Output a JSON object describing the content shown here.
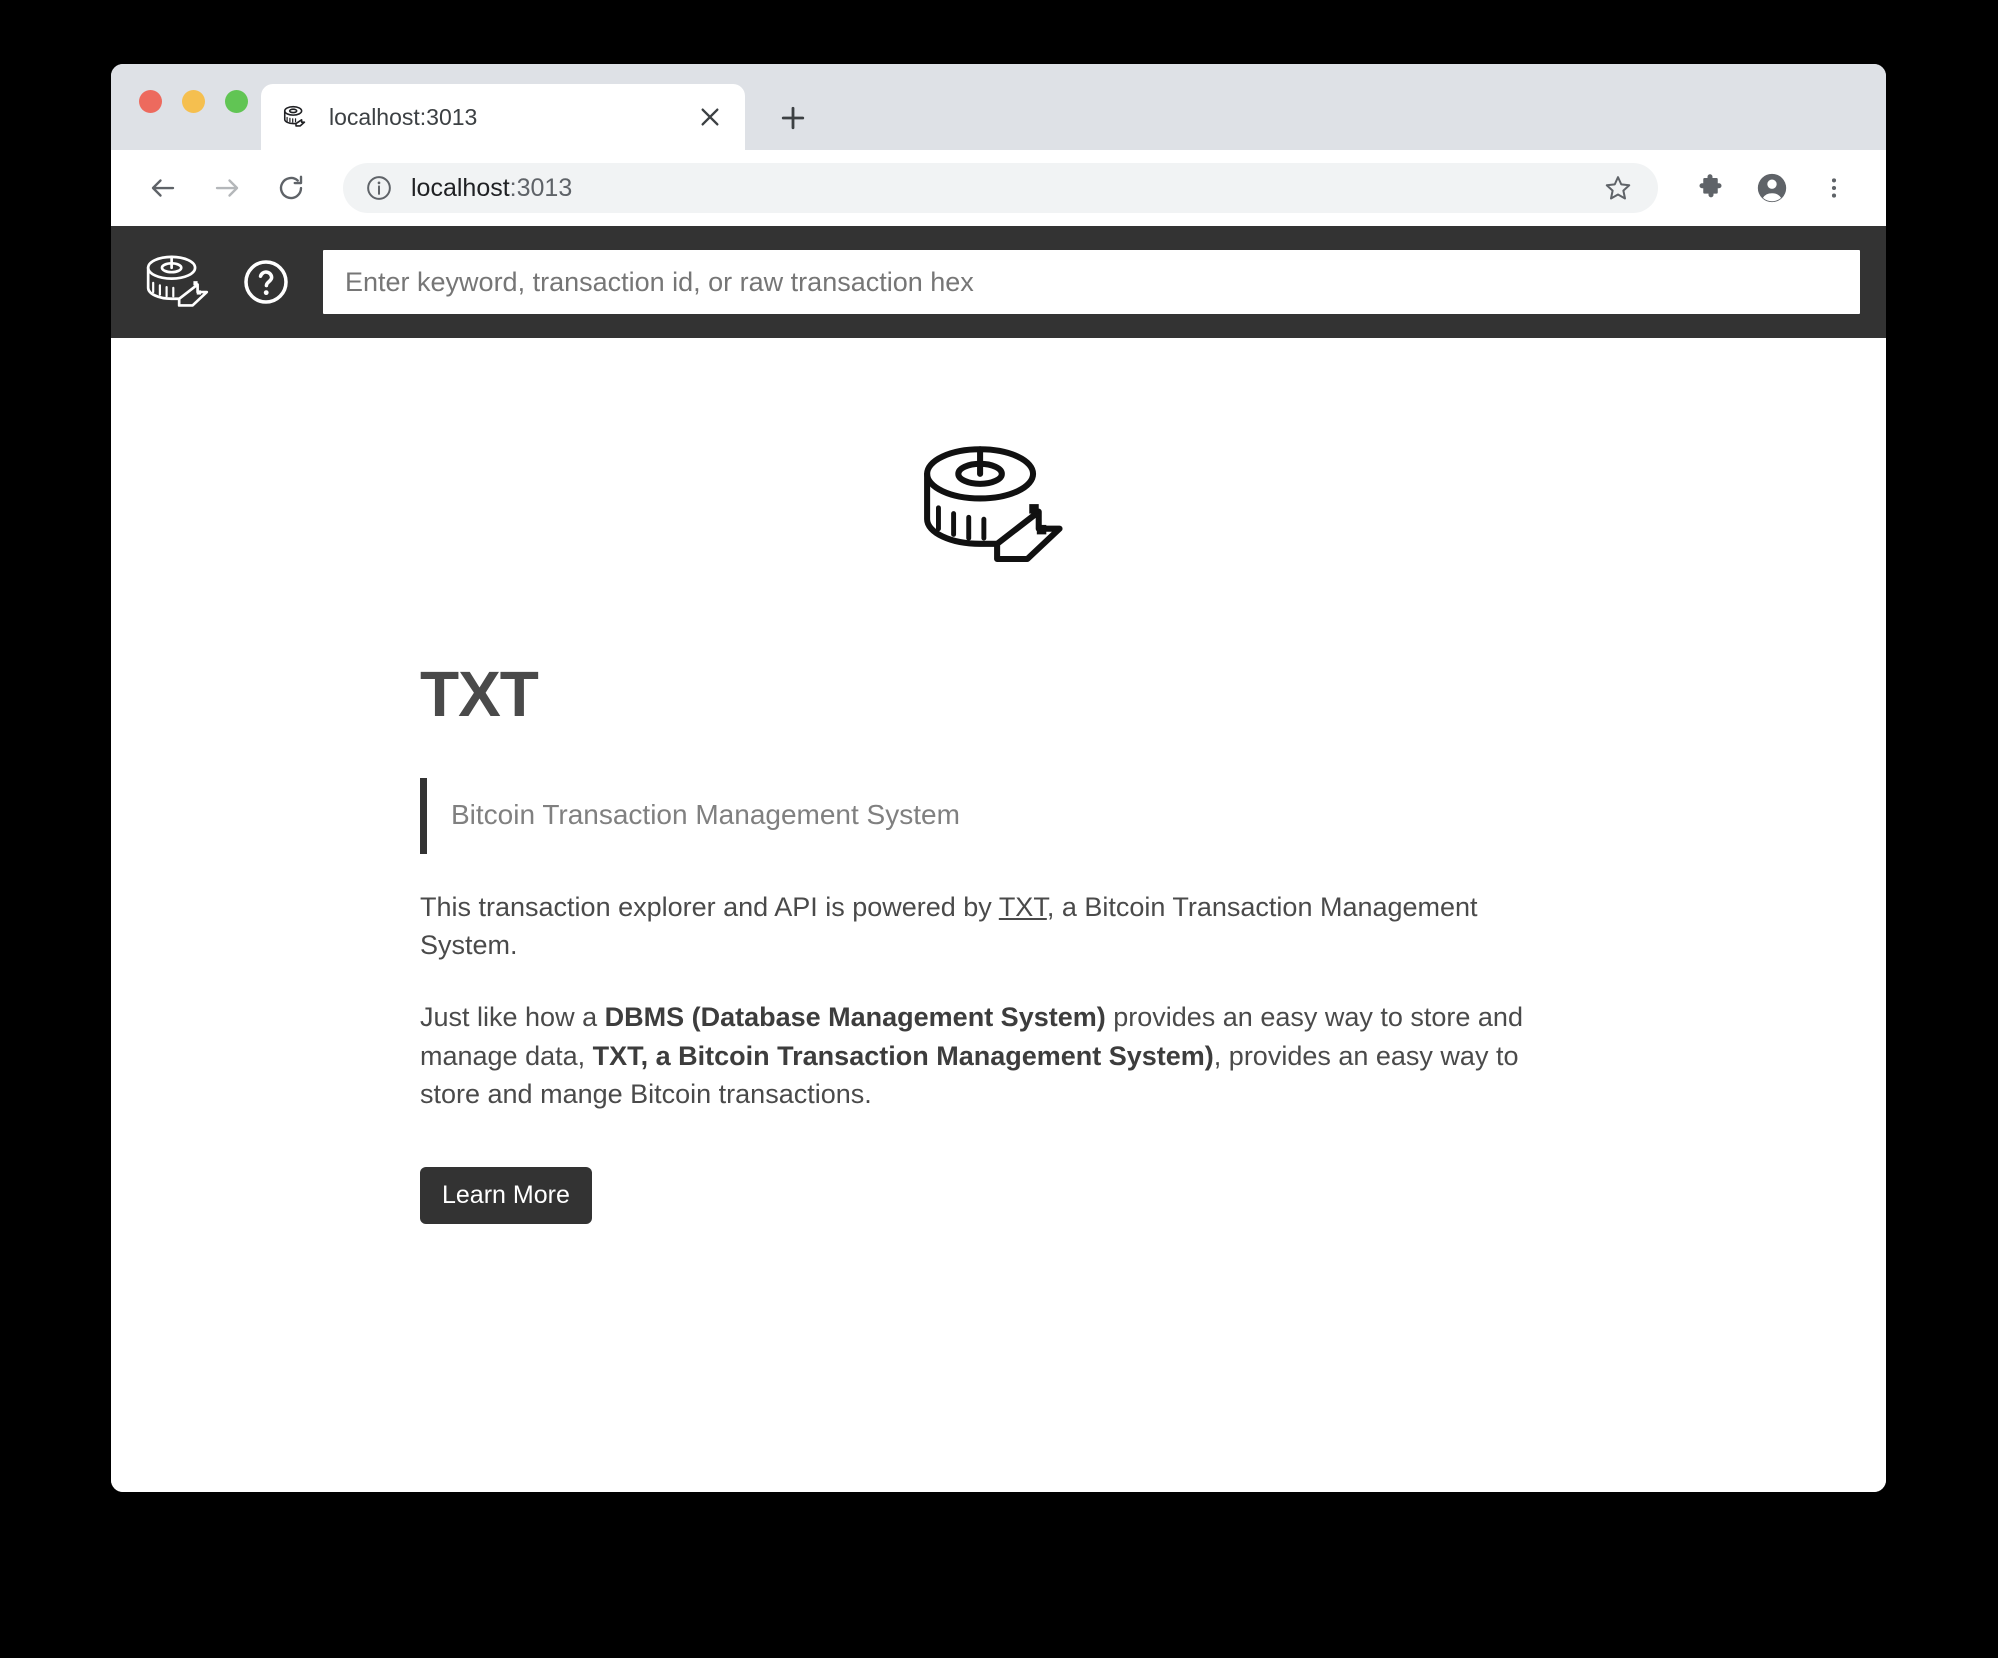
{
  "browser": {
    "tab": {
      "title": "localhost:3013",
      "favicon_icon": "tape-measure-icon",
      "close_icon": "close-icon"
    },
    "new_tab_icon": "plus-icon",
    "nav": {
      "back_icon": "arrow-left-icon",
      "forward_icon": "arrow-right-icon",
      "reload_icon": "reload-icon"
    },
    "omnibox": {
      "info_icon": "info-circle-icon",
      "url_host": "localhost",
      "url_port": ":3013",
      "star_icon": "star-icon"
    },
    "toolbar_icons": {
      "extensions": "puzzle-icon",
      "profile": "account-circle-icon",
      "menu": "three-dot-menu-icon"
    }
  },
  "app": {
    "header": {
      "logo_icon": "tape-measure-icon",
      "help_icon": "help-circle-icon",
      "search_placeholder": "Enter keyword, transaction id, or raw transaction hex",
      "search_value": ""
    },
    "hero": {
      "logo_icon": "tape-measure-icon",
      "title": "TXT",
      "tagline": "Bitcoin Transaction Management System",
      "paragraph1": {
        "before_link": "This transaction explorer and API is powered by ",
        "link": "TXT",
        "after_link": ", a Bitcoin Transaction Management System."
      },
      "paragraph2": {
        "part1": "Just like how a ",
        "bold1": "DBMS (Database Management System)",
        "part2": " provides an easy way to store and manage data, ",
        "bold2": "TXT, a Bitcoin Transaction Management System)",
        "part3": ", provides an easy way to store and mange Bitcoin transactions."
      },
      "learn_more_label": "Learn More"
    }
  },
  "colors": {
    "header_dark": "#333333",
    "text_body": "#4a4a4a",
    "tagline_gray": "#808080",
    "tab_strip": "#dee1e6",
    "traffic_red": "#ed6a5e",
    "traffic_yellow": "#f5bf4f",
    "traffic_green": "#61c554"
  }
}
